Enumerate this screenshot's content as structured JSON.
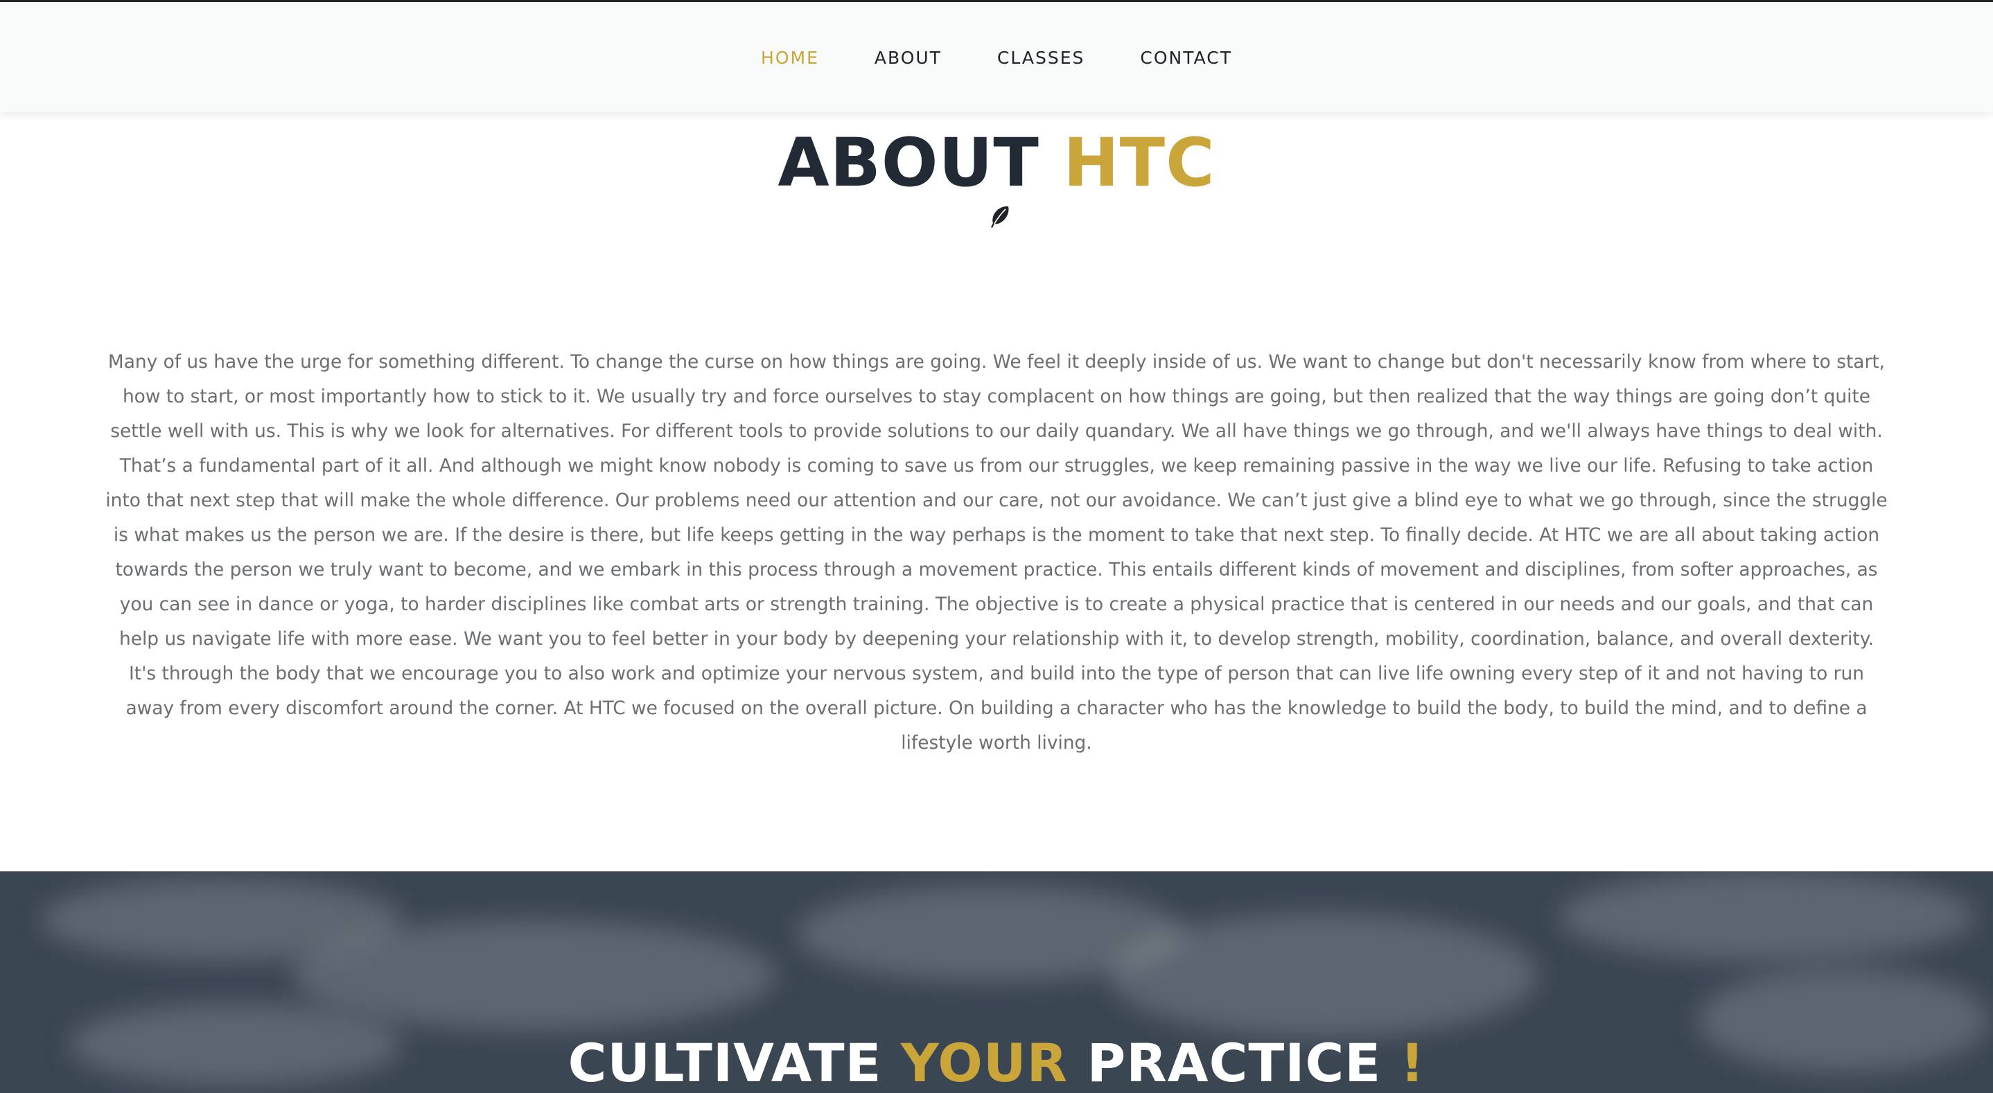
{
  "nav": {
    "items": [
      {
        "label": "HOME",
        "active": true
      },
      {
        "label": "ABOUT",
        "active": false
      },
      {
        "label": "CLASSES",
        "active": false
      },
      {
        "label": "CONTACT",
        "active": false
      }
    ]
  },
  "about": {
    "title_main": "ABOUT",
    "title_accent": "HTC",
    "icon": "feather-icon",
    "paragraph": "Many of us have the urge for something different. To change the curse on how things are going. We feel it deeply inside of us. We want to change but don't necessarily know from where to start, how to start, or most importantly how to stick to it. We usually try and force ourselves to stay complacent on how things are going, but then realized that the way things are going don’t quite settle well with us. This is why we look for alternatives. For different tools to provide solutions to our daily quandary. We all have things we go through, and we'll always have things to deal with. That’s a fundamental part of it all. And although we might know nobody is coming to save us from our struggles, we keep remaining passive in the way we live our life. Refusing to take action into that next step that will make the whole difference. Our problems need our attention and our care, not our avoidance. We can’t just give a blind eye to what we go through, since the struggle is what makes us the person we are. If the desire is there, but life keeps getting in the way perhaps is the moment to take that next step. To finally decide. At HTC we are all about taking action towards the person we truly want to become, and we embark in this process through a movement practice. This entails different kinds of movement and disciplines, from softer approaches, as you can see in dance or yoga, to harder disciplines like combat arts or strength training. The objective is to create a physical practice that is centered in our needs and our goals, and that can help us navigate life with more ease. We want you to feel better in your body by deepening your relationship with it, to develop strength, mobility, coordination, balance, and overall dexterity. It's through the body that we encourage you to also work and optimize your nervous system, and build into the type of person that can live life owning every step of it and not having to run away from every discomfort around the corner. At HTC we focused on the overall picture. On building a character who has the knowledge to build the body, to build the mind, and to define a lifestyle worth living."
  },
  "hero": {
    "word1": "CULTIVATE",
    "word2": "YOUR",
    "word3": "PRACTICE",
    "punct": "!"
  },
  "colors": {
    "accent": "#c9a53a",
    "heading_dark": "#222a35",
    "body_text": "#6b6e73",
    "hero_bg": "#3b4653"
  }
}
